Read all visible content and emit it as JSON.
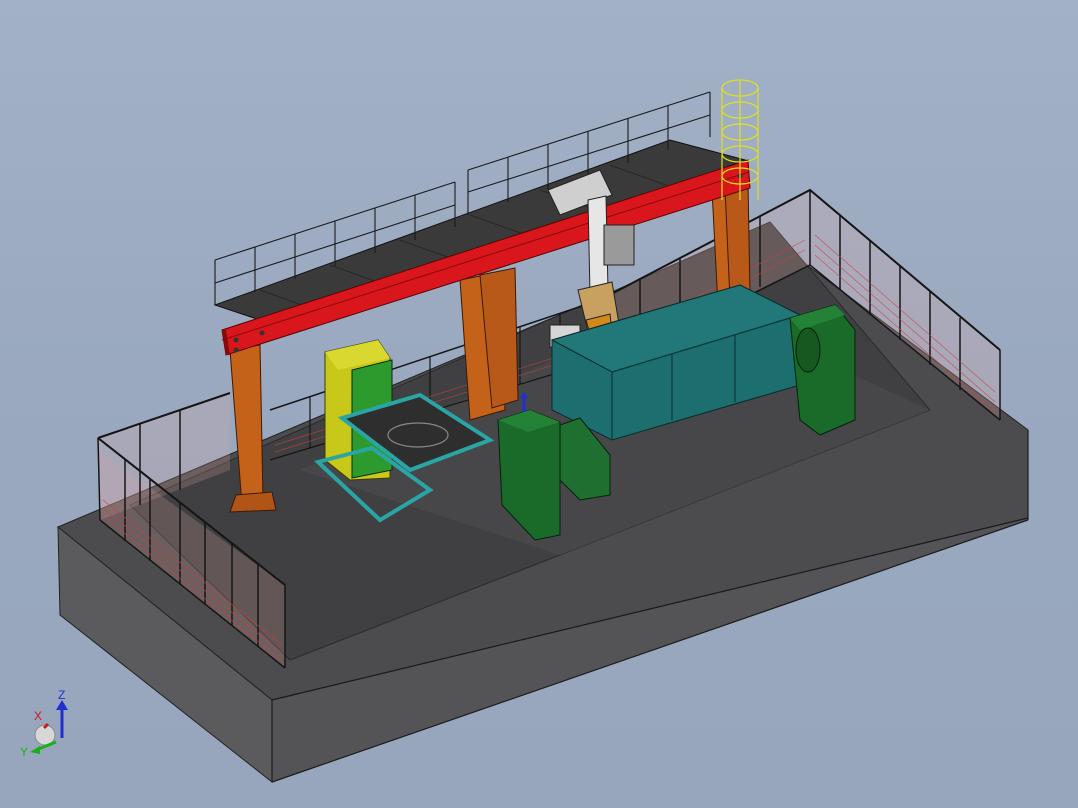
{
  "viewport": {
    "background_top": "#a3b1c7",
    "background_bottom": "#97a6bd"
  },
  "triad": {
    "x_label": "X",
    "y_label": "Y",
    "z_label": "Z",
    "x_color": "#d01818",
    "y_color": "#18b018",
    "z_color": "#2030d0"
  },
  "colors": {
    "platform_top": "#4b4b4d",
    "platform_side": "#5a5a5c",
    "floor_inner": "#3e3e40",
    "gantry_beam": "#d8161b",
    "gantry_columns": "#c4621a",
    "walkway": "#3c3c3c",
    "left_positioner": "#c8c81a",
    "fixture_frame": "#2aa5a5",
    "drum_workpiece": "#1d6e6e",
    "headstock": "#1a6a2a",
    "fence": "#1a1a1a",
    "fence_mesh": "#c83838",
    "ladder": "#e0e020"
  }
}
